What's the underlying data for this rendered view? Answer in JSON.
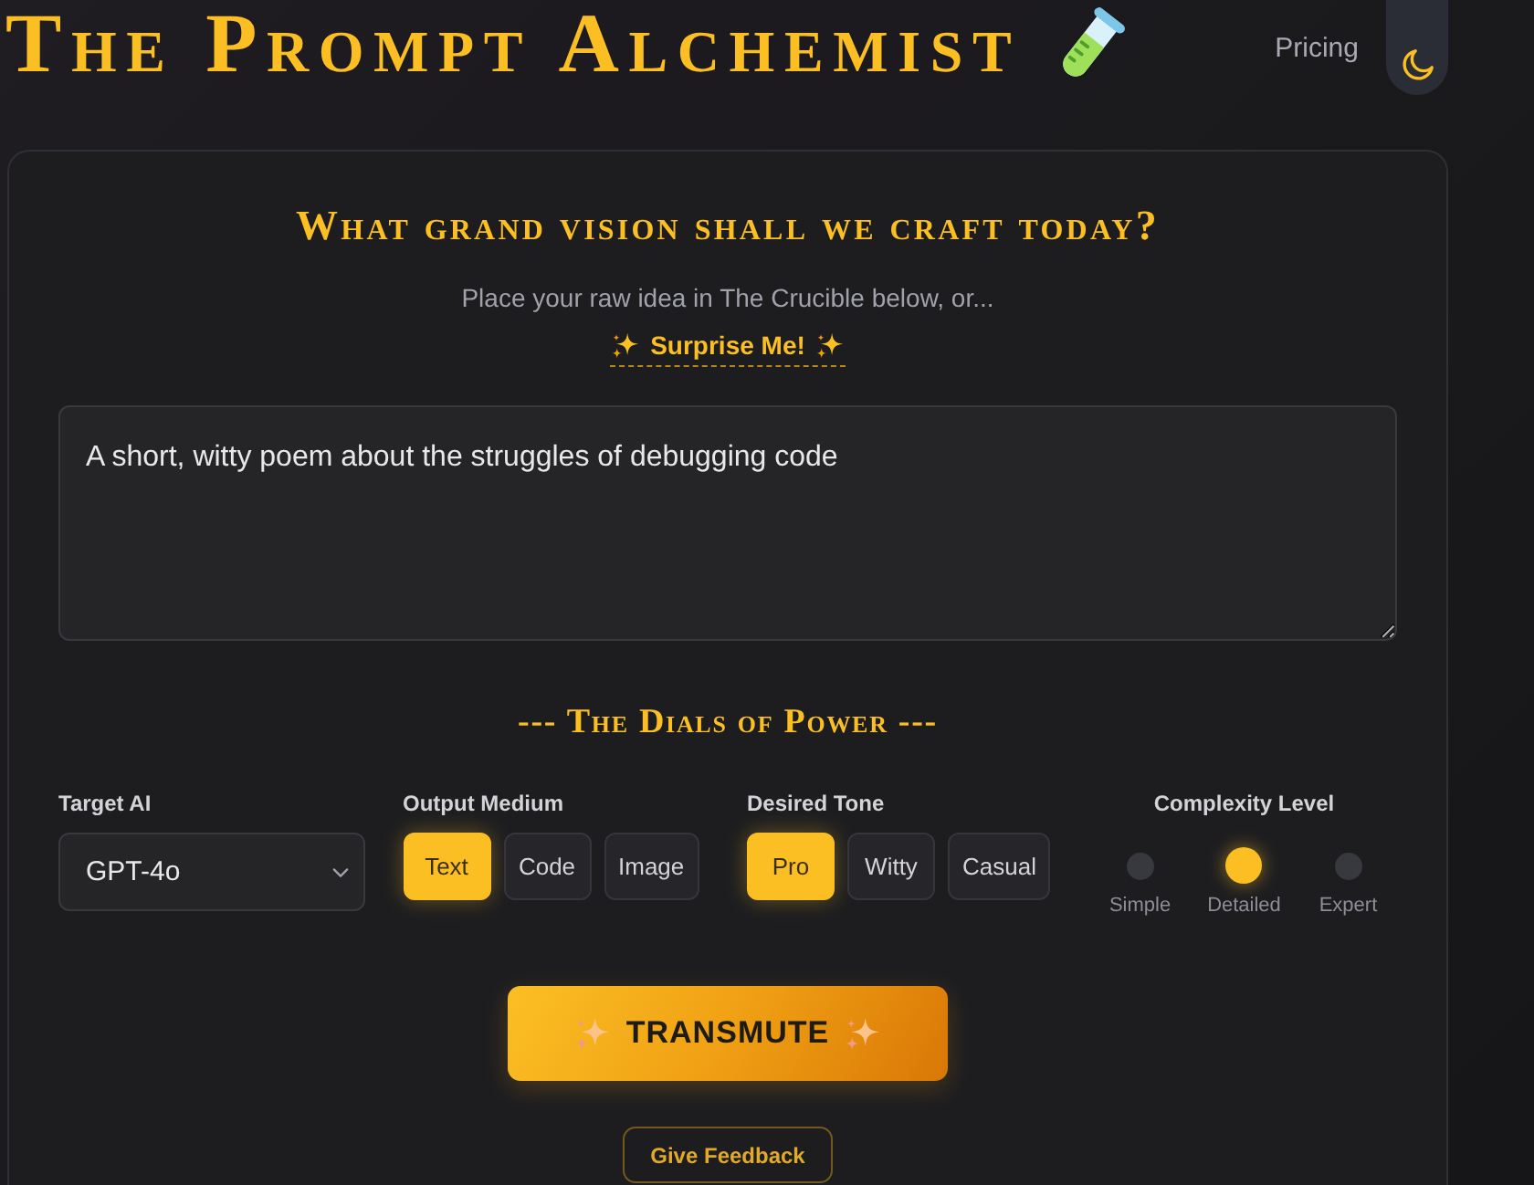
{
  "header": {
    "title": "The Prompt Alchemist",
    "nav": [
      {
        "label": "Pricing"
      }
    ]
  },
  "prompt_card": {
    "heading": "What grand vision shall we craft today?",
    "subtitle": "Place your raw idea in The Crucible below, or...",
    "surprise_link": "Surprise Me!",
    "idea": {
      "value": "A short, witty poem about the struggles of debugging code"
    }
  },
  "dials": {
    "heading": "--- The Dials of Power ---",
    "target_ai": {
      "label": "Target AI",
      "value": "GPT-4o"
    },
    "output_medium": {
      "label": "Output Medium",
      "options": [
        {
          "label": "Text",
          "selected": true
        },
        {
          "label": "Code",
          "selected": false
        },
        {
          "label": "Image",
          "selected": false
        }
      ]
    },
    "desired_tone": {
      "label": "Desired Tone",
      "options": [
        {
          "label": "Pro",
          "selected": true
        },
        {
          "label": "Witty",
          "selected": false
        },
        {
          "label": "Casual",
          "selected": false
        }
      ]
    },
    "complexity_level": {
      "label": "Complexity Level",
      "options": [
        {
          "label": "Simple",
          "selected": false
        },
        {
          "label": "Detailed",
          "selected": true
        },
        {
          "label": "Expert",
          "selected": false
        }
      ]
    }
  },
  "actions": {
    "primary": "TRANSMUTE",
    "secondary": "Give Feedback"
  }
}
